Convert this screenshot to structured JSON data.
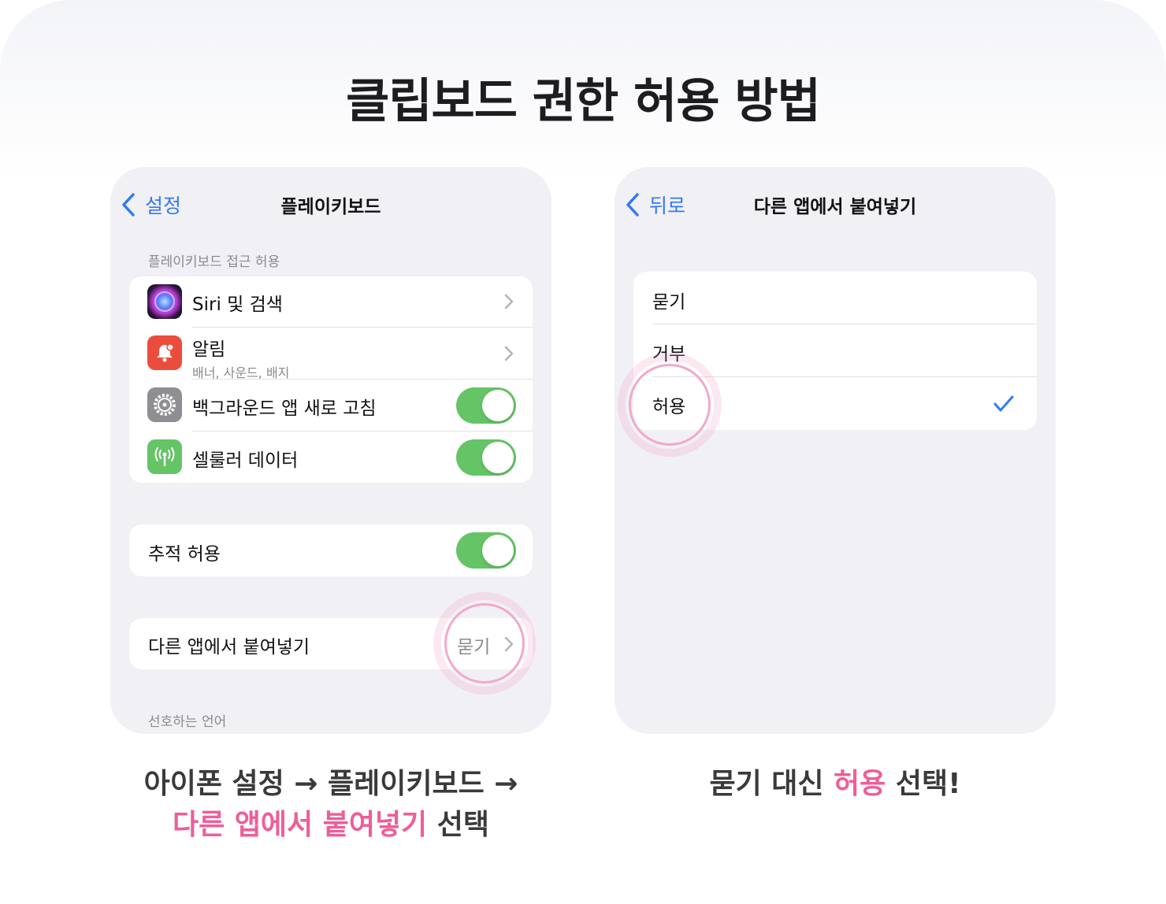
{
  "title": "클립보드 권한 허용 방법",
  "left_screen": {
    "back_label": "설정",
    "nav_title": "플레이키보드",
    "section1_label": "플레이키보드 접근 허용",
    "rows": [
      {
        "label": "Siri 및 검색",
        "icon": "siri-icon"
      },
      {
        "label": "알림",
        "sublabel": "배너, 사운드, 배지",
        "icon": "notification-bell-icon"
      },
      {
        "label": "백그라운드 앱 새로 고침",
        "icon": "gear-icon",
        "toggle": true
      },
      {
        "label": "셀룰러 데이터",
        "icon": "antenna-icon",
        "toggle": true
      }
    ],
    "tracking_label": "추적 허용",
    "paste_label": "다른 앱에서 붙여넣기",
    "paste_value": "묻기",
    "section3_label": "선호하는 언어"
  },
  "right_screen": {
    "back_label": "뒤로",
    "nav_title": "다른 앱에서 붙여넣기",
    "options": [
      {
        "label": "묻기",
        "selected": false
      },
      {
        "label": "거부",
        "selected": false
      },
      {
        "label": "허용",
        "selected": true
      }
    ]
  },
  "captions": {
    "left_line1": "아이폰 설정 → 플레이키보드 →",
    "left_line2_pink": "다른 앱에서 붙여넣기",
    "left_line2_rest": " 선택",
    "right_part1": "묻기 대신 ",
    "right_pink": "허용",
    "right_part2": " 선택!"
  },
  "colors": {
    "accent_blue": "#3478f6",
    "toggle_green": "#65c466",
    "highlight_pink": "#ee5e98"
  }
}
